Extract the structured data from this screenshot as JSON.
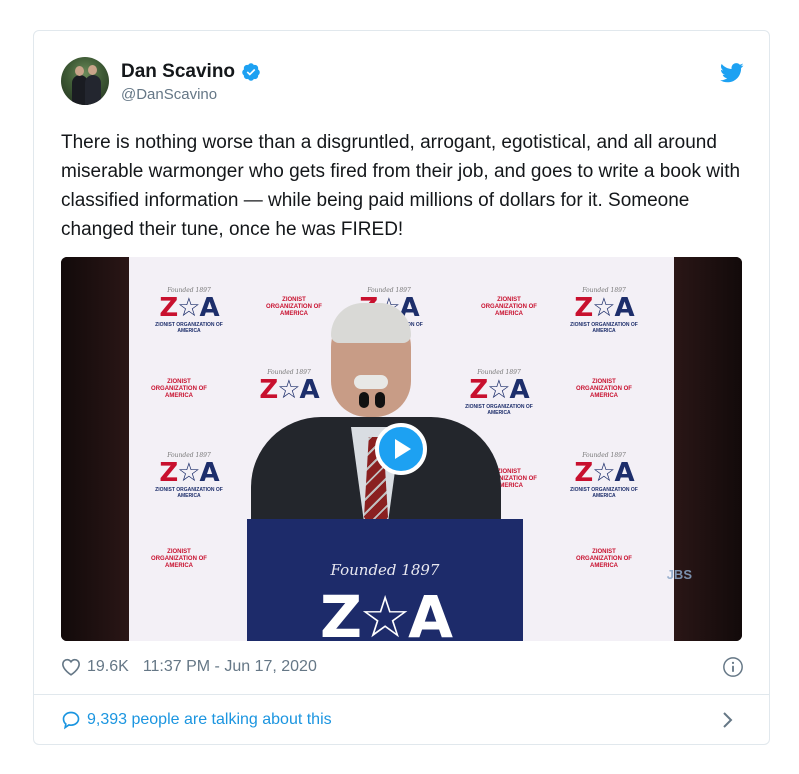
{
  "tweet": {
    "display_name": "Dan Scavino",
    "handle": "@DanScavino",
    "verified": true,
    "text": "There is nothing worse than a disgruntled, arrogant, egotistical, and all around miserable warmonger who gets fired from their job, and goes to write a book with classified information — while being paid millions of dollars for it. Someone changed their tune, once he was FIRED!",
    "likes": "19.6K",
    "timestamp": "11:37 PM - Jun 17, 2020",
    "talking": "9,393 people are talking about this"
  },
  "media": {
    "type": "video",
    "logo_letters_left": "Z",
    "logo_letters_right": "A",
    "logo_caption": "ZIONIST ORGANIZATION OF AMERICA",
    "logo_founded": "Founded 1897",
    "podium_founded": "Founded 1897",
    "watermark": "JBS"
  },
  "colors": {
    "accent": "#1da1f2",
    "link": "#1b95e0",
    "muted": "#657786",
    "border": "#e1e8ed"
  },
  "icons": {
    "verified": "verified-badge-icon",
    "brand": "twitter-bird-icon",
    "like": "heart-icon",
    "info": "info-icon",
    "talk": "speech-bubble-icon",
    "more": "chevron-right-icon",
    "play": "play-icon"
  }
}
